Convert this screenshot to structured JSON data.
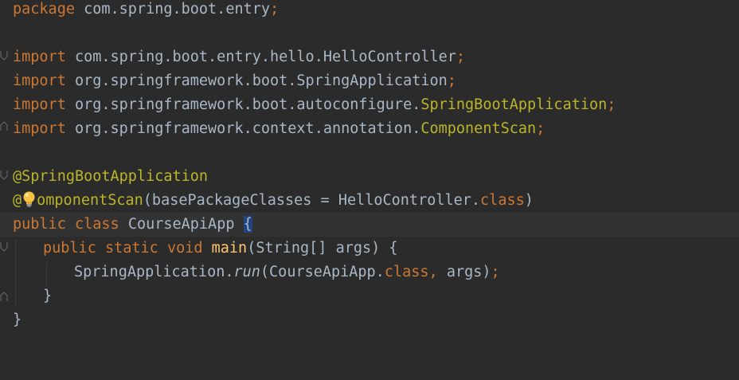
{
  "editor": {
    "colors": {
      "background": "#2b2b2b",
      "current_line": "#323232",
      "keyword": "#cc7832",
      "annotation": "#bbb529",
      "method": "#ffc66d",
      "text": "#a9b7c6",
      "brace_highlight": "#214283"
    },
    "lines": {
      "l1": {
        "kw": "package",
        "pkg": "com.spring.boot.entry",
        "semi": ";"
      },
      "l3": {
        "kw": "import",
        "path": "com.spring.boot.entry.hello.HelloController",
        "semi": ";"
      },
      "l4": {
        "kw": "import",
        "path": "org.springframework.boot.SpringApplication",
        "semi": ";"
      },
      "l5": {
        "kw": "import",
        "path": "org.springframework.boot.autoconfigure.",
        "cls": "SpringBootApplication",
        "semi": ";"
      },
      "l6": {
        "kw": "import",
        "path": "org.springframework.context.annotation.",
        "cls": "ComponentScan",
        "semi": ";"
      },
      "l8": {
        "ann": "@SpringBootApplication"
      },
      "l9": {
        "ann_prefix": "@",
        "ann_rest": "omponentScan",
        "open": "(basePackageClasses = HelloController.",
        "kw": "class",
        "close": ")"
      },
      "l10": {
        "kw1": "public",
        "kw2": "class",
        "name": "CourseApiApp",
        "brace": "{"
      },
      "l11": {
        "kw1": "public",
        "kw2": "static",
        "kw3": "void",
        "method": "main",
        "params": "(String[] args) {"
      },
      "l12": {
        "cls": "SpringApplication.",
        "method": "run",
        "open": "(CourseApiApp.",
        "kw": "class",
        "comma": ",",
        "args": " args)",
        "semi": ";"
      },
      "l13": {
        "brace": "}"
      },
      "l14": {
        "brace": "}"
      }
    },
    "icons": {
      "intention": "lightbulb-icon",
      "fold": "fold-marker-icon"
    }
  }
}
